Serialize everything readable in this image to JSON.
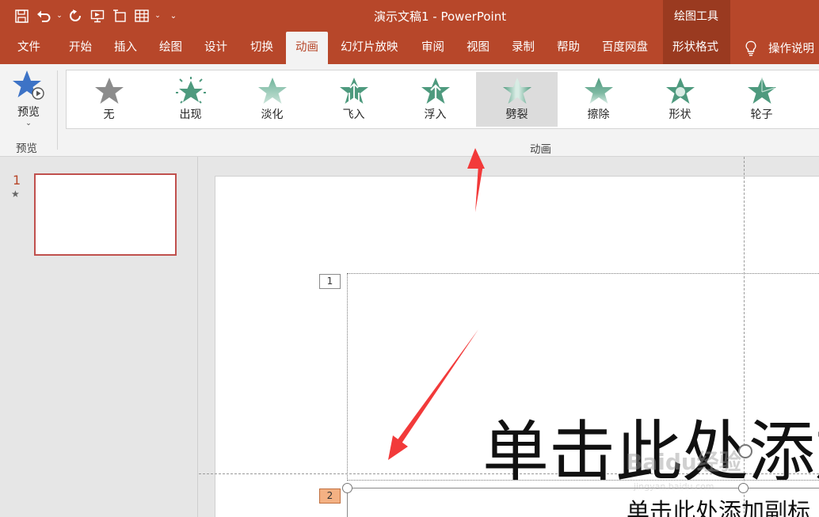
{
  "window": {
    "title": "演示文稿1  -  PowerPoint",
    "context_tab_group": "绘图工具"
  },
  "ribbon_tabs": [
    {
      "label": "文件"
    },
    {
      "label": "开始"
    },
    {
      "label": "插入"
    },
    {
      "label": "绘图"
    },
    {
      "label": "设计"
    },
    {
      "label": "切换"
    },
    {
      "label": "动画",
      "active": true
    },
    {
      "label": "幻灯片放映"
    },
    {
      "label": "审阅"
    },
    {
      "label": "视图"
    },
    {
      "label": "录制"
    },
    {
      "label": "帮助"
    },
    {
      "label": "百度网盘"
    },
    {
      "label": "形状格式",
      "contextual": true
    }
  ],
  "tell_me": "操作说明",
  "preview_group": {
    "button_label": "预览",
    "group_label": "预览"
  },
  "animation_group": {
    "group_label": "动画",
    "effects": [
      {
        "label": "无",
        "icon": "star-none-icon"
      },
      {
        "label": "出现",
        "icon": "star-appear-icon"
      },
      {
        "label": "淡化",
        "icon": "star-fade-icon"
      },
      {
        "label": "飞入",
        "icon": "star-flyin-icon"
      },
      {
        "label": "浮入",
        "icon": "star-floatin-icon"
      },
      {
        "label": "劈裂",
        "icon": "star-split-icon",
        "selected": true
      },
      {
        "label": "擦除",
        "icon": "star-wipe-icon"
      },
      {
        "label": "形状",
        "icon": "star-shape-icon"
      },
      {
        "label": "轮子",
        "icon": "star-wheel-icon"
      }
    ]
  },
  "slides_pane": {
    "slide_number": "1",
    "has_animation_marker": "★"
  },
  "slide": {
    "title_placeholder": "单击此处添加",
    "subtitle_placeholder": "单击此处添加副标",
    "animation_tag_1": "1",
    "animation_tag_2": "2"
  },
  "watermark": {
    "text": "Baidu经验",
    "sub": "jingyan.baidu.com"
  },
  "colors": {
    "brand": "#b7472a",
    "context_tab": "#9a3a20",
    "star_active": "#5a9c84",
    "star_inactive": "#8c8c8c",
    "arrow": "#f23a3a"
  }
}
